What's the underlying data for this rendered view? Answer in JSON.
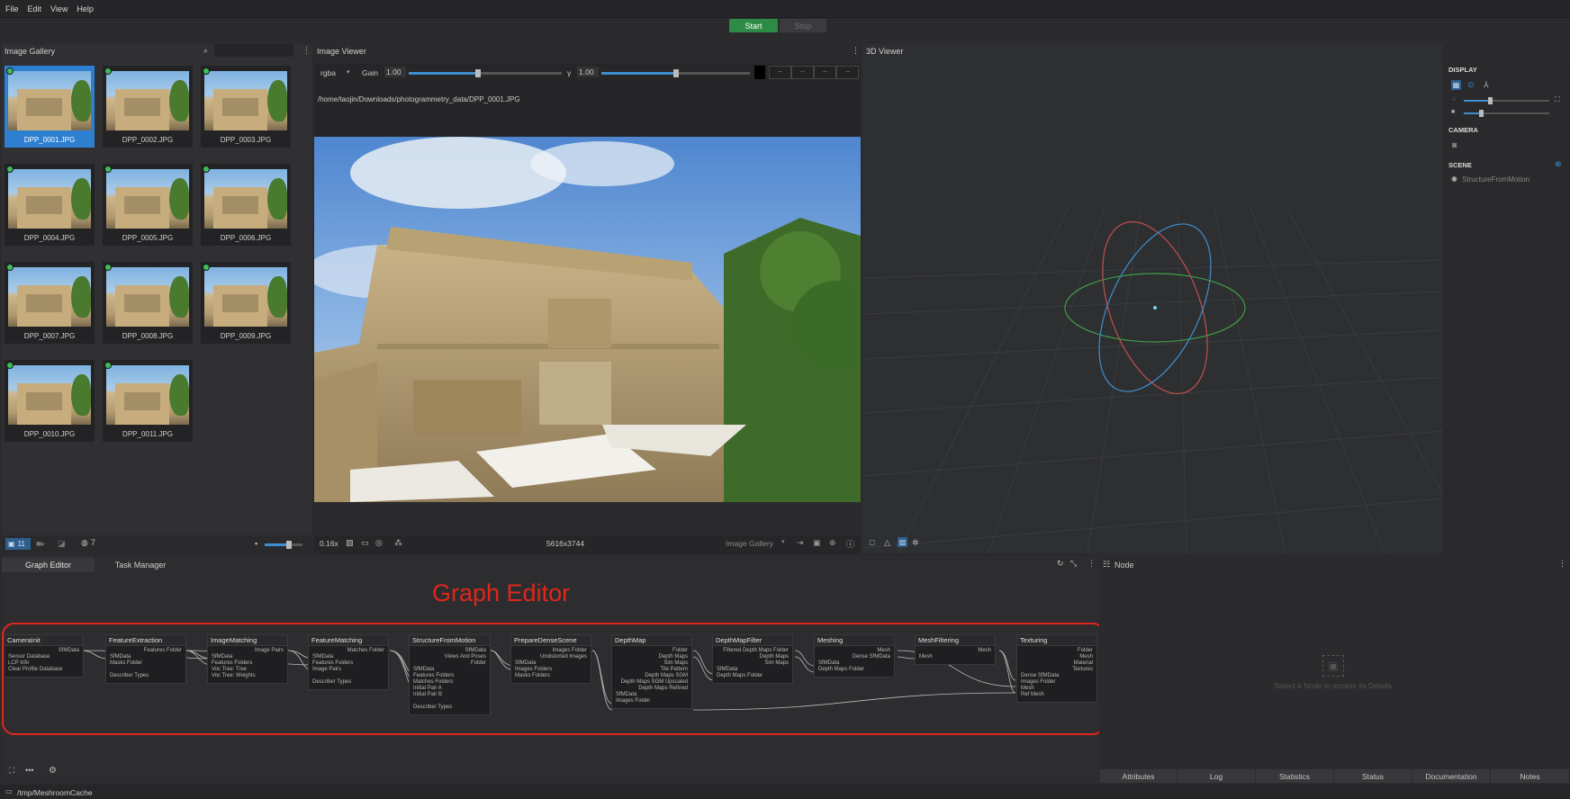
{
  "menu": [
    "File",
    "Edit",
    "View",
    "Help"
  ],
  "toolbar": {
    "start_label": "Start",
    "stop_label": "Stop"
  },
  "gallery": {
    "title": "Image Gallery",
    "images": [
      "DPP_0001.JPG",
      "DPP_0002.JPG",
      "DPP_0003.JPG",
      "DPP_0004.JPG",
      "DPP_0005.JPG",
      "DPP_0006.JPG",
      "DPP_0007.JPG",
      "DPP_0008.JPG",
      "DPP_0009.JPG",
      "DPP_0010.JPG",
      "DPP_0011.JPG"
    ],
    "count": "11",
    "intrinsics_count": "7"
  },
  "viewer": {
    "title": "Image Viewer",
    "channel": "rgba",
    "gain_label": "Gain",
    "gain_value": "1.00",
    "gamma_label": "γ",
    "gamma_value": "1.00",
    "gain_level": 0.45,
    "gamma_level": 0.5,
    "pixel_fields": [
      "--",
      "--",
      "--",
      "--"
    ],
    "path": "/home/taojin/Downloads/photogrammetry_data/DPP_0001.JPG",
    "zoom": "0.16x",
    "resolution": "5616x3744",
    "source": "Image Gallery"
  },
  "viewer3d": {
    "title": "3D Viewer",
    "display_label": "DISPLAY",
    "camera_label": "CAMERA",
    "scene_label": "SCENE",
    "scene_item": "StructureFromMotion",
    "colors": {
      "x": "#c05050",
      "y": "#3f9f4a",
      "z": "#3f8fd0"
    }
  },
  "graph": {
    "tabs": [
      "Graph Editor",
      "Task Manager"
    ],
    "annotation": "Graph Editor",
    "nodes": [
      {
        "title": "CameraInit",
        "inputs": [
          "Sensor Database",
          "LCP Info",
          "Clear Profile Database"
        ],
        "outputs": [
          "SfMData"
        ]
      },
      {
        "title": "FeatureExtraction",
        "inputs": [
          "SfMData",
          "Masks Folder",
          "",
          "Describer Types"
        ],
        "outputs": [
          "Features Folder"
        ]
      },
      {
        "title": "ImageMatching",
        "inputs": [
          "SfMData",
          "Features Folders",
          "Voc Tree: Tree",
          "Voc Tree: Weights"
        ],
        "outputs": [
          "Image Pairs"
        ]
      },
      {
        "title": "FeatureMatching",
        "inputs": [
          "SfMData",
          "Features Folders",
          "Image Pairs",
          "",
          "Describer Types"
        ],
        "outputs": [
          "Matches Folder"
        ]
      },
      {
        "title": "StructureFromMotion",
        "inputs": [
          "SfMData",
          "Features Folders",
          "Matches Folders",
          "Initial Pair A",
          "Initial Pair B",
          "",
          "Describer Types"
        ],
        "outputs": [
          "SfMData",
          "Views And Poses",
          "Folder"
        ]
      },
      {
        "title": "PrepareDenseScene",
        "inputs": [
          "SfMData",
          "Images Folders",
          "Masks Folders"
        ],
        "outputs": [
          "Images Folder",
          "Undistorted Images"
        ]
      },
      {
        "title": "DepthMap",
        "inputs": [
          "SfMData",
          "Images Folder"
        ],
        "outputs": [
          "Folder",
          "Depth Maps",
          "Sim Maps",
          "Tile Pattern",
          "Depth Maps SGM",
          "Depth Maps SGM Upscaled",
          "Depth Maps Refined"
        ]
      },
      {
        "title": "DepthMapFilter",
        "inputs": [
          "SfMData",
          "Depth Maps Folder"
        ],
        "outputs": [
          "Filtered Depth Maps Folder",
          "Depth Maps",
          "Sim Maps"
        ]
      },
      {
        "title": "Meshing",
        "inputs": [
          "SfMData",
          "Depth Maps Folder"
        ],
        "outputs": [
          "Mesh",
          "Dense SfMData"
        ]
      },
      {
        "title": "MeshFiltering",
        "inputs": [
          "Mesh"
        ],
        "outputs": [
          "Mesh"
        ]
      },
      {
        "title": "Texturing",
        "inputs": [
          "Dense SfMData",
          "Images Folder",
          "Mesh",
          "Ref Mesh"
        ],
        "outputs": [
          "Folder",
          "Mesh",
          "Material",
          "Textures"
        ]
      }
    ]
  },
  "nodepanel": {
    "title": "Node",
    "hint": "Select a Node to access its Details",
    "tabs": [
      "Attributes",
      "Log",
      "Statistics",
      "Status",
      "Documentation",
      "Notes"
    ]
  },
  "status": {
    "cache_path": "/tmp/MeshroomCache"
  }
}
